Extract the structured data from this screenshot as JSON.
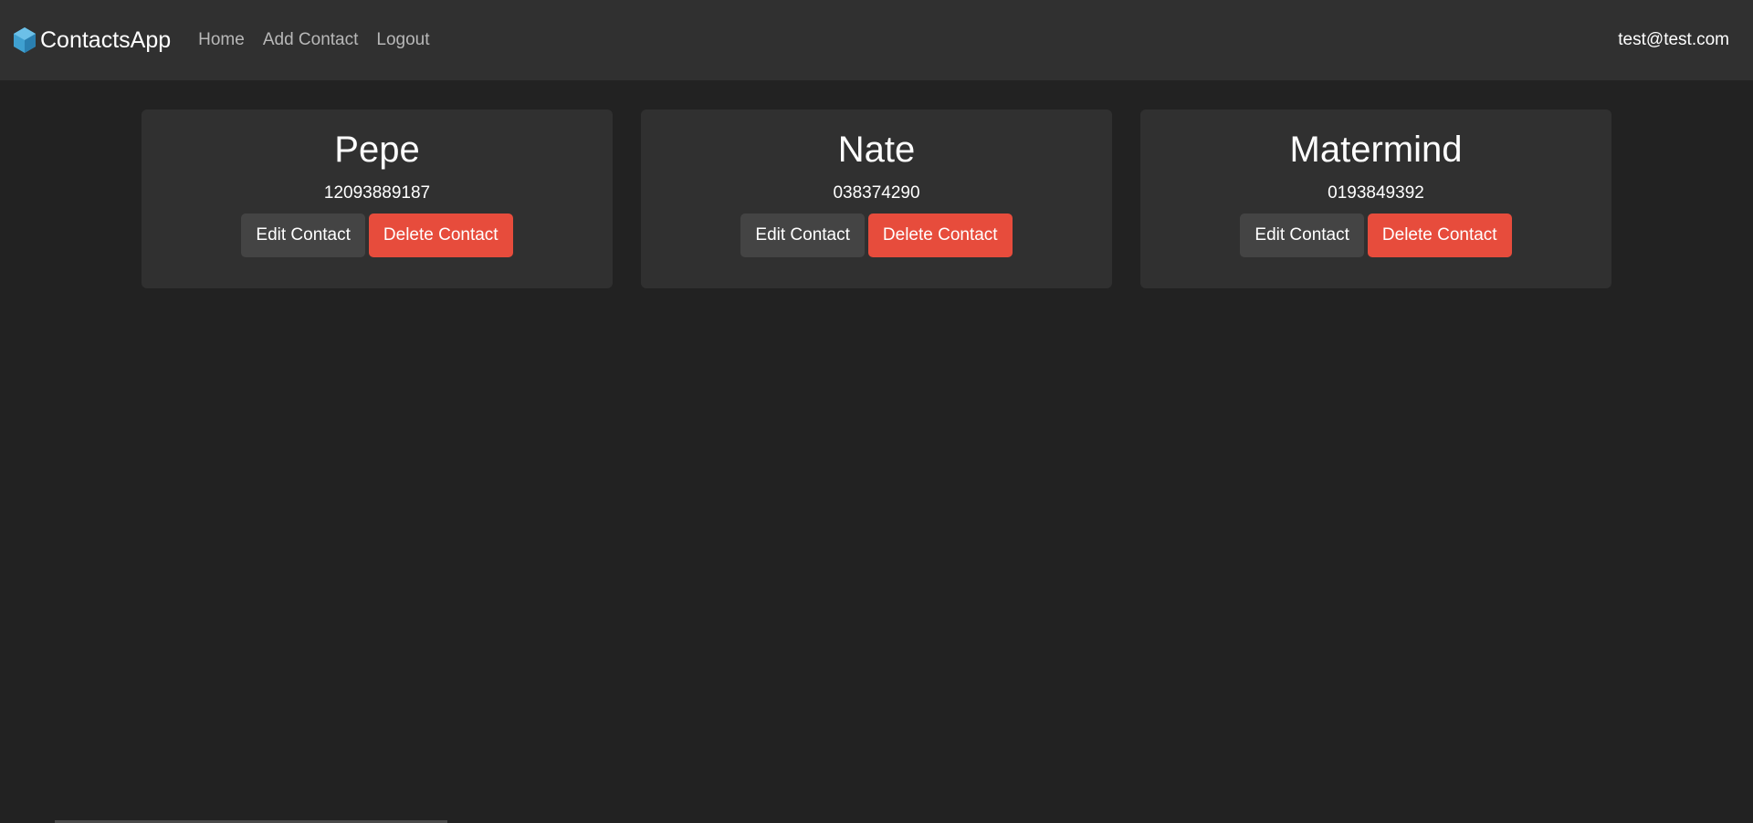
{
  "navbar": {
    "brand": "ContactsApp",
    "links": [
      {
        "label": "Home"
      },
      {
        "label": "Add Contact"
      },
      {
        "label": "Logout"
      }
    ],
    "user_email": "test@test.com"
  },
  "contacts": [
    {
      "name": "Pepe",
      "phone": "12093889187",
      "edit_label": "Edit Contact",
      "delete_label": "Delete Contact"
    },
    {
      "name": "Nate",
      "phone": "038374290",
      "edit_label": "Edit Contact",
      "delete_label": "Delete Contact"
    },
    {
      "name": "Matermind",
      "phone": "0193849392",
      "edit_label": "Edit Contact",
      "delete_label": "Delete Contact"
    }
  ],
  "colors": {
    "background": "#222222",
    "navbar": "#303030",
    "card": "#303030",
    "edit_button": "#444444",
    "delete_button": "#e74c3c",
    "brand_icon": "#3fa0d0"
  }
}
